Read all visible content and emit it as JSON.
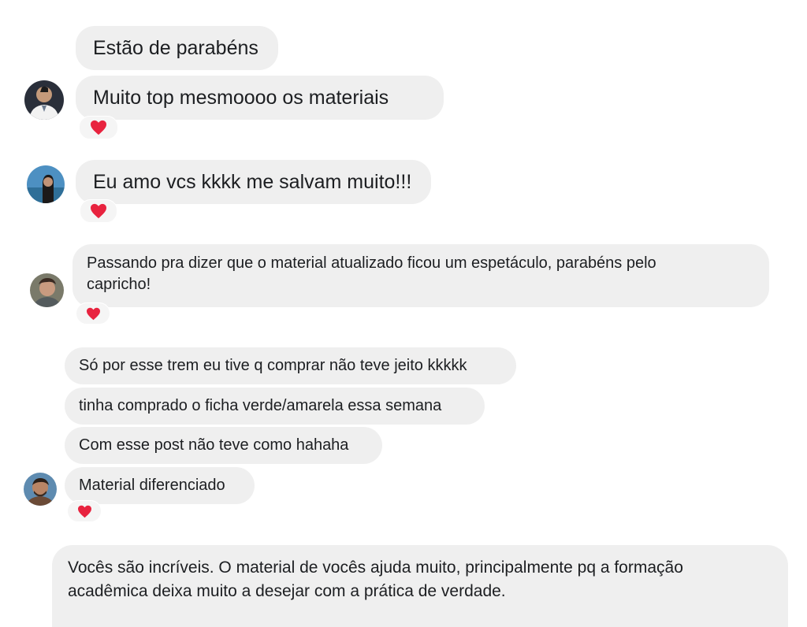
{
  "conversations": [
    {
      "messages": [
        "Estão de parabéns",
        "Muito top mesmoooo os materiais"
      ],
      "reaction": "heart-icon"
    },
    {
      "messages": [
        "Eu amo vcs kkkk me salvam muito!!!"
      ],
      "reaction": "heart-icon"
    },
    {
      "messages": [
        "Passando pra dizer que o material atualizado ficou um espetáculo, parabéns pelo capricho!"
      ],
      "reaction": "heart-icon"
    },
    {
      "messages": [
        "Só por esse trem eu tive q comprar não teve jeito kkkkk",
        "tinha comprado o ficha verde/amarela essa semana",
        "Com esse post não teve como hahaha",
        "Material diferenciado"
      ],
      "reaction": "heart-icon"
    },
    {
      "messages": [
        "Vocês são incríveis. O material de vocês ajuda muito, principalmente pq a formação acadêmica deixa muito a desejar com a prática de verdade."
      ]
    }
  ],
  "colors": {
    "bubble": "#efefef",
    "heart": "#e8233f",
    "text": "#1c1e21"
  }
}
